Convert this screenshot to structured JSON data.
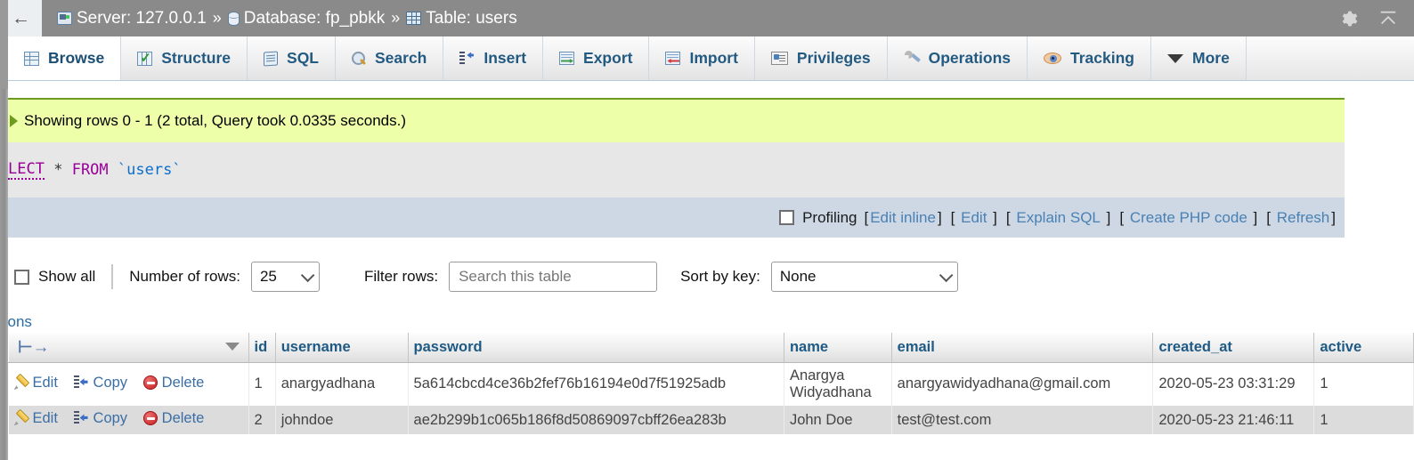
{
  "topbar": {
    "back_label": "←",
    "server_icon": "server-icon",
    "server_label": "Server: 127.0.0.1",
    "sep1": "»",
    "db_icon": "database-icon",
    "db_label": "Database: fp_pbkk",
    "sep2": "»",
    "table_icon": "table-icon",
    "table_label": "Table: users",
    "gear_icon": "gear-icon",
    "collapse_icon": "collapse-up-icon"
  },
  "tabs": [
    {
      "label": "Browse",
      "icon": "browse-icon",
      "active": true
    },
    {
      "label": "Structure",
      "icon": "structure-icon",
      "active": false
    },
    {
      "label": "SQL",
      "icon": "sql-icon",
      "active": false
    },
    {
      "label": "Search",
      "icon": "search-icon",
      "active": false
    },
    {
      "label": "Insert",
      "icon": "insert-icon",
      "active": false
    },
    {
      "label": "Export",
      "icon": "export-icon",
      "active": false
    },
    {
      "label": "Import",
      "icon": "import-icon",
      "active": false
    },
    {
      "label": "Privileges",
      "icon": "privileges-icon",
      "active": false
    },
    {
      "label": "Operations",
      "icon": "operations-icon",
      "active": false
    },
    {
      "label": "Tracking",
      "icon": "tracking-icon",
      "active": false
    },
    {
      "label": "More",
      "icon": "chevron-down-icon",
      "active": false
    }
  ],
  "notice": {
    "text": "Showing rows 0 - 1 (2 total, Query took 0.0335 seconds.)",
    "bg_color": "#eeffaa",
    "border_color": "#6c9b1e"
  },
  "query": {
    "keyword_select": "LECT",
    "star": "*",
    "keyword_from": "FROM",
    "table_ref": "`users`",
    "full_text": "LECT * FROM `users`"
  },
  "profiling": {
    "checkbox_label": "Profiling",
    "checked": false,
    "links": [
      {
        "open": "[",
        "label": "Edit inline",
        "close": "]"
      },
      {
        "open": "[",
        "label": "Edit",
        "close": "]"
      },
      {
        "open": "[",
        "label": "Explain SQL",
        "close": "]"
      },
      {
        "open": "[",
        "label": "Create PHP code",
        "close": "]"
      },
      {
        "open": "[",
        "label": "Refresh",
        "close": "]"
      }
    ]
  },
  "controls": {
    "show_all_label": "Show all",
    "show_all_checked": false,
    "number_of_rows_label": "Number of rows:",
    "number_of_rows_value": "25",
    "filter_rows_label": "Filter rows:",
    "filter_rows_value": "",
    "filter_rows_placeholder": "Search this table",
    "sort_by_key_label": "Sort by key:",
    "sort_by_key_value": "None"
  },
  "results": {
    "options_label": "tions",
    "actions_header": "",
    "columns": [
      "id",
      "username",
      "password",
      "name",
      "email",
      "created_at",
      "active"
    ],
    "rows": [
      {
        "edit": "Edit",
        "copy": "Copy",
        "delete": "Delete",
        "id": "1",
        "username": "anargyadhana",
        "password": "5a614cbcd4ce36b2fef76b16194e0d7f51925adb",
        "name": "Anargya Widyadhana",
        "email": "anargyawidyadhana@gmail.com",
        "created_at": "2020-05-23 03:31:29",
        "active": "1"
      },
      {
        "edit": "Edit",
        "copy": "Copy",
        "delete": "Delete",
        "id": "2",
        "username": "johndoe",
        "password": "ae2b299b1c065b186f8d50869097cbff26ea283b",
        "name": "John Doe",
        "email": "test@test.com",
        "created_at": "2020-05-23 21:46:11",
        "active": "1"
      }
    ]
  },
  "colors": {
    "topbar_bg": "#8a8a8a",
    "tab_text": "#235a81",
    "link": "#4a81b4",
    "profbar_bg": "#cdd8e4",
    "alt_row_bg": "#dcdcdc"
  }
}
